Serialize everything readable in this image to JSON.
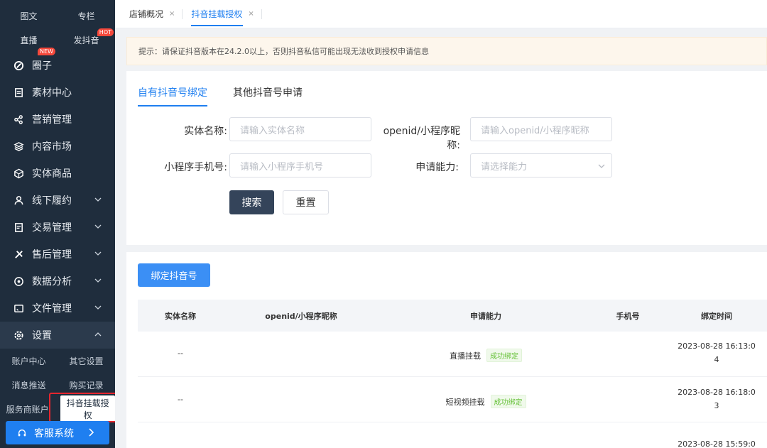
{
  "sidebar": {
    "top_grid": [
      {
        "left": "图文",
        "right": "专栏"
      },
      {
        "left": "直播",
        "right": "发抖音",
        "right_badge": "HOT"
      }
    ],
    "menu": [
      {
        "label": "圈子",
        "icon": "circle-icon",
        "badge": "NEW",
        "chevron": false
      },
      {
        "label": "素材中心",
        "icon": "material-icon",
        "chevron": false
      },
      {
        "label": "营销管理",
        "icon": "marketing-icon",
        "chevron": false
      },
      {
        "label": "内容市场",
        "icon": "layers-icon",
        "chevron": false
      },
      {
        "label": "实体商品",
        "icon": "box-icon",
        "chevron": false
      },
      {
        "label": "线下履约",
        "icon": "user-icon",
        "chevron": true
      },
      {
        "label": "交易管理",
        "icon": "trade-icon",
        "chevron": true
      },
      {
        "label": "售后管理",
        "icon": "service-icon",
        "chevron": true
      },
      {
        "label": "数据分析",
        "icon": "data-icon",
        "chevron": true
      },
      {
        "label": "文件管理",
        "icon": "folder-icon",
        "chevron": true
      },
      {
        "label": "设置",
        "icon": "gear-icon",
        "chevron": true,
        "active": true
      }
    ],
    "settings_sub": [
      {
        "left": "账户中心",
        "right": "其它设置"
      },
      {
        "left": "消息推送",
        "right": "购买记录"
      },
      {
        "left": "服务商账户",
        "right": "抖音挂载授权"
      }
    ],
    "cs_button": "客服系统"
  },
  "tabs": [
    {
      "label": "店铺概况",
      "active": false
    },
    {
      "label": "抖音挂载授权",
      "active": true
    }
  ],
  "notice": "提示：请保证抖音版本在24.2.0以上，否则抖音私信可能出现无法收到授权申请信息",
  "sub_tabs": [
    "自有抖音号绑定",
    "其他抖音号申请"
  ],
  "form": {
    "entity_label": "实体名称:",
    "entity_placeholder": "请输入实体名称",
    "openid_label": "openid/小程序昵称:",
    "openid_placeholder": "请输入openid/小程序昵称",
    "phone_label": "小程序手机号:",
    "phone_placeholder": "请输入小程序手机号",
    "ability_label": "申请能力:",
    "ability_placeholder": "请选择能力",
    "search_btn": "搜索",
    "reset_btn": "重置"
  },
  "bind_btn": "绑定抖音号",
  "table": {
    "headers": [
      "实体名称",
      "openid/小程序昵称",
      "申请能力",
      "手机号",
      "绑定时间"
    ],
    "rows": [
      {
        "entity": "--",
        "ability": "直播挂载",
        "status": "成功绑定",
        "time_a": "2023-08-28 16:13:0",
        "time_b": "4"
      },
      {
        "entity": "--",
        "ability": "短视频挂载",
        "status": "成功绑定",
        "time_a": "2023-08-28 16:18:0",
        "time_b": "3"
      },
      {
        "entity": "",
        "ability": "",
        "status": "",
        "time_a": "2023-08-28 15:59:0",
        "time_b": ""
      }
    ]
  }
}
